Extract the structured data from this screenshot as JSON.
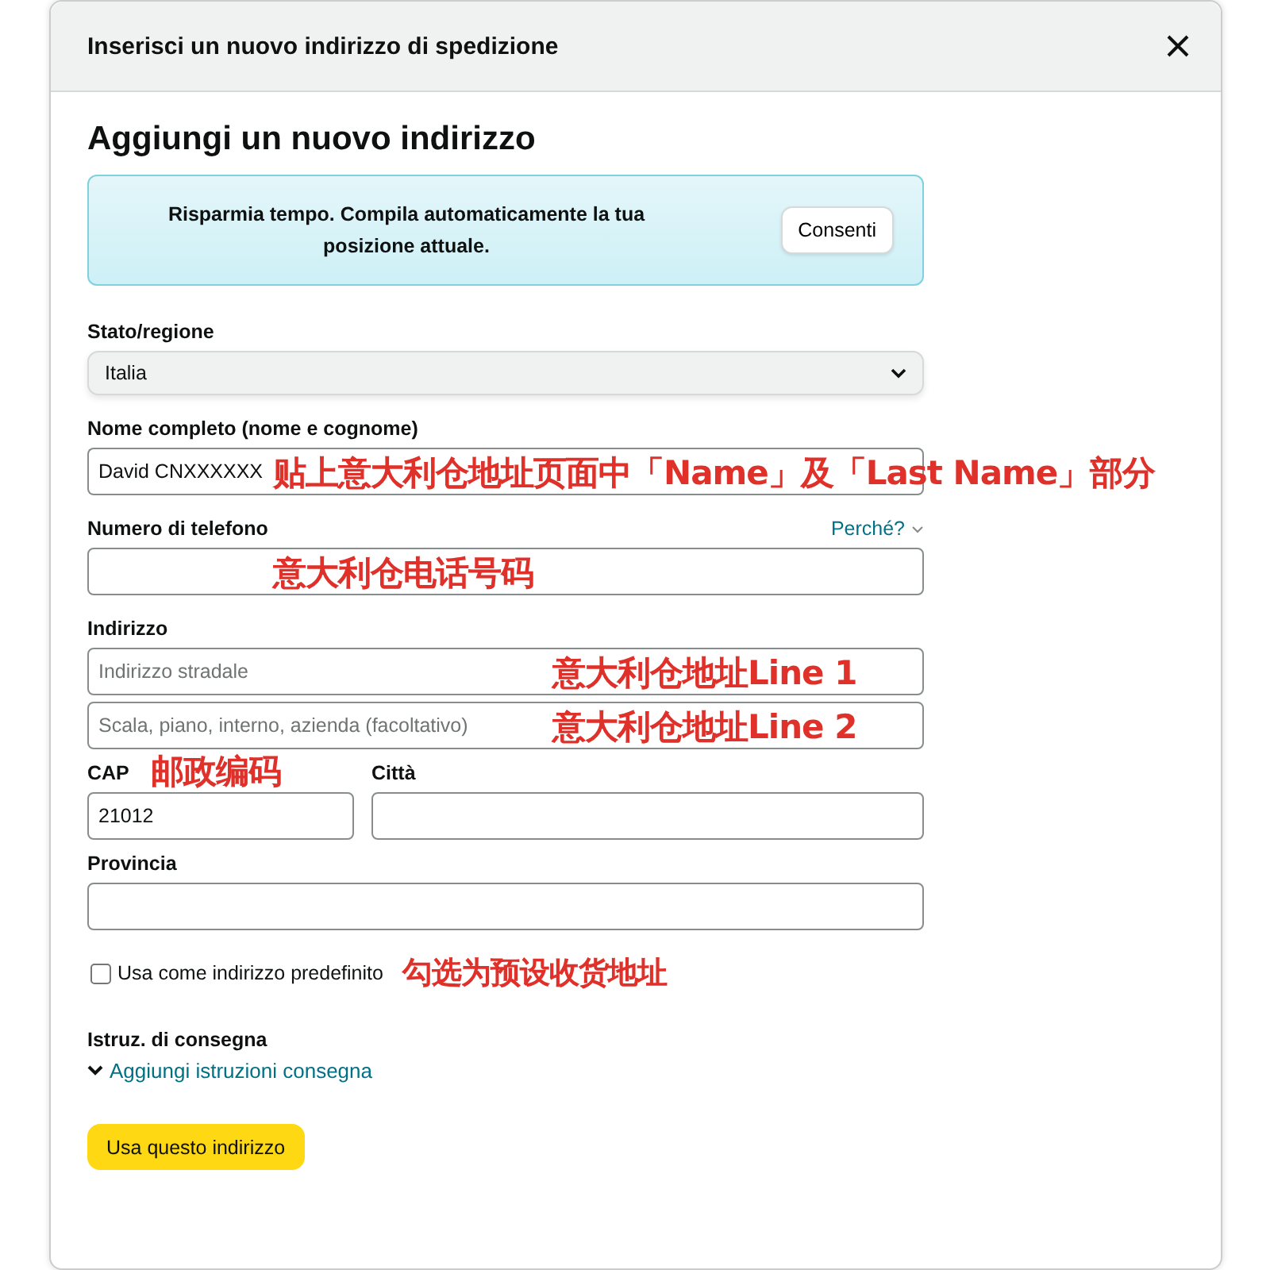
{
  "dialog": {
    "title": "Inserisci un nuovo indirizzo di spedizione"
  },
  "heading": "Aggiungi un nuovo indirizzo",
  "location_banner": {
    "text": "Risparmia tempo. Compila automaticamente la tua posizione attuale.",
    "button": "Consenti"
  },
  "country": {
    "label": "Stato/regione",
    "value": "Italia"
  },
  "full_name": {
    "label": "Nome completo (nome e cognome)",
    "value": "David CNXXXXXX",
    "annotation": "贴上意大利仓地址页面中「Name」及「Last Name」部分"
  },
  "phone": {
    "label": "Numero di telefono",
    "link": "Perché?",
    "annotation": "意大利仓电话号码"
  },
  "address": {
    "label": "Indirizzo",
    "lines": [
      {
        "placeholder": "Indirizzo stradale",
        "annotation": "意大利仓地址Line 1"
      },
      {
        "placeholder": "Scala, piano, interno, azienda (facoltativo)",
        "annotation": "意大利仓地址Line 2"
      }
    ]
  },
  "postal_code": {
    "label": "CAP",
    "value": "21012",
    "annotation": "邮政编码"
  },
  "city": {
    "label": "Città"
  },
  "province": {
    "label": "Provincia"
  },
  "default_address": {
    "label": "Usa come indirizzo predefinito",
    "checked": false,
    "annotation": "勾选为预设收货地址"
  },
  "delivery": {
    "label": "Istruz. di consegna",
    "link": "Aggiungi istruzioni consegna"
  },
  "submit": "Usa questo indirizzo"
}
